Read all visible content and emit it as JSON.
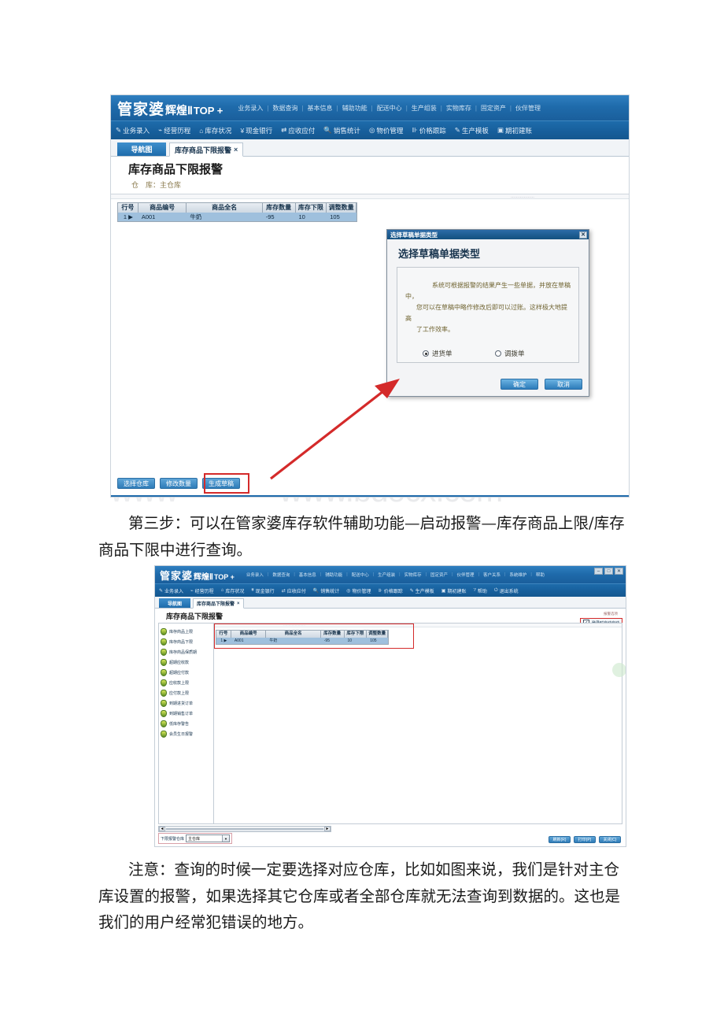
{
  "document": {
    "watermark": "www.bdocx.com",
    "paragraphs": [
      {
        "id": "step3",
        "text": "第三步：可以在管家婆库存软件辅助功能—启动报警—库存商品上限/库存商品下限中进行查询。"
      },
      {
        "id": "note",
        "text": "注意：查询的时候一定要选择对应仓库，比如如图来说，我们是针对主仓库设置的报警，如果选择其它仓库或者全部仓库就无法查询到数据的。这也是我们的用户经常犯错误的地方。"
      }
    ]
  },
  "screenshot1": {
    "brand": {
      "cn": "管家婆",
      "product": "辉煌Ⅱ",
      "suffix": "TOP +"
    },
    "topmenu": [
      "业务录入",
      "数据查询",
      "基本信息",
      "辅助功能",
      "配送中心",
      "生产组装",
      "实物库存",
      "固定资产",
      "伙伴管理"
    ],
    "toolbar": [
      {
        "icon": "entry-icon",
        "label": "业务录入"
      },
      {
        "icon": "chart-icon",
        "label": "经营历程"
      },
      {
        "icon": "warehouse-icon",
        "label": "库存状况"
      },
      {
        "icon": "yen-icon",
        "label": "现金银行"
      },
      {
        "icon": "exchange-icon",
        "label": "应收应付"
      },
      {
        "icon": "search-icon",
        "label": "销售统计"
      },
      {
        "icon": "gear-icon",
        "label": "物价管理"
      },
      {
        "icon": "bars-icon",
        "label": "价格跟踪"
      },
      {
        "icon": "wrench-icon",
        "label": "生产模板"
      },
      {
        "icon": "book-icon",
        "label": "期初建账"
      }
    ],
    "tabs": {
      "nav": "导航图",
      "active": "库存商品下限报警",
      "close": "×"
    },
    "page_title": "库存商品下限报警",
    "warehouse_label": "仓　库：",
    "warehouse_value": "主仓库",
    "grid": {
      "columns": [
        "行号",
        "商品编号",
        "商品全名",
        "库存数量",
        "库存下限",
        "调整数量"
      ],
      "rows": [
        {
          "seq": "1",
          "code": "A001",
          "name": "牛奶",
          "qty": "-95",
          "lower": "10",
          "adjust": "105"
        }
      ]
    },
    "footer_buttons": [
      "选择仓库",
      "修改数量",
      "生成草稿"
    ],
    "highlight_button": "生成草稿",
    "dialog": {
      "titlebar": "选择草稿单据类型",
      "close": "✕",
      "heading": "选择草稿单据类型",
      "body_lines": [
        "系统可根据报警的结果产生一些单据，并放在草稿中，",
        "您可以在草稿中略作修改后即可以过账。这样极大地提高",
        "了工作效率。"
      ],
      "options": [
        {
          "label": "进货单",
          "selected": true
        },
        {
          "label": "调拨单",
          "selected": false
        }
      ],
      "ok": "确定",
      "cancel": "取消"
    }
  },
  "screenshot2": {
    "brand": {
      "cn": "管家婆",
      "product": "辉煌Ⅱ",
      "suffix": "TOP +"
    },
    "topmenu": [
      "业务录入",
      "数据查询",
      "基本信息",
      "辅助功能",
      "配送中心",
      "生产组装",
      "实物库存",
      "固定资产",
      "伙伴管理",
      "客户关系",
      "系统维护",
      "帮助"
    ],
    "toolbar": [
      {
        "icon": "entry-icon",
        "label": "业务录入"
      },
      {
        "icon": "chart-icon",
        "label": "经营历程"
      },
      {
        "icon": "warehouse-icon",
        "label": "库存状况"
      },
      {
        "icon": "yen-icon",
        "label": "现金银行"
      },
      {
        "icon": "exchange-icon",
        "label": "应收应付"
      },
      {
        "icon": "search-icon",
        "label": "销售统计"
      },
      {
        "icon": "gear-icon",
        "label": "物价管理"
      },
      {
        "icon": "bars-icon",
        "label": "价格跟踪"
      },
      {
        "icon": "wrench-icon",
        "label": "生产模板"
      },
      {
        "icon": "book-icon",
        "label": "期初建账"
      },
      {
        "icon": "help-icon",
        "label": "帮助"
      },
      {
        "icon": "exit-icon",
        "label": "退出系统"
      }
    ],
    "window_controls": [
      "–",
      "□",
      "✕"
    ],
    "tabs": {
      "nav": "导航图",
      "active": "库存商品下限报警",
      "close": "×"
    },
    "page_title": "库存商品下限报警",
    "tree_items": [
      "库存商品上限",
      "库存商品下限",
      "库存商品保质期",
      "超期应收款",
      "超期应付款",
      "应收款上限",
      "应付款上限",
      "到期进货订单",
      "到期销售订单",
      "低库存警告",
      "会员生日报警"
    ],
    "grid": {
      "columns": [
        "行号",
        "商品编号",
        "商品全名",
        "库存数量",
        "库存下限",
        "调整数量"
      ],
      "rows": [
        {
          "seq": "1",
          "code": "A001",
          "name": "牛奶",
          "qty": "-95",
          "lower": "10",
          "adjust": "105"
        }
      ]
    },
    "autostart": {
      "label": "登录时自动启动",
      "checked": true,
      "hint": "报警选项"
    },
    "bottom_filter": {
      "label": "下限报警仓库",
      "value": "主仓库"
    },
    "bottom_buttons": [
      "刷新(R)",
      "打印(P)",
      "关闭(C)"
    ]
  },
  "colors": {
    "brand_blue": "#1f6bab",
    "toolbar_blue": "#175f9c",
    "grid_row": "#9fc0dd",
    "annotation_red": "#d42a2a",
    "dialog_text": "#6f6330"
  }
}
